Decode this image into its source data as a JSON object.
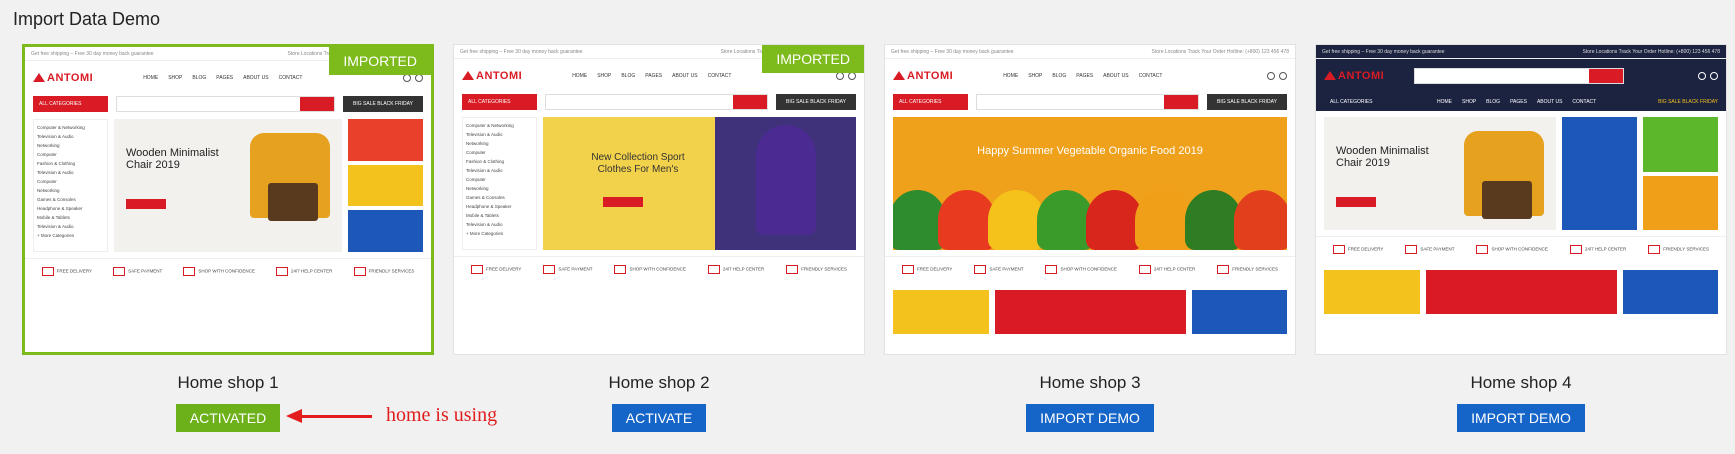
{
  "page": {
    "title": "Import Data Demo"
  },
  "badge": "IMPORTED",
  "preview": {
    "topbar_left": "Get free shipping – Free 30 day money back guarantee",
    "topbar_right": "Store Locations   Track Your Order   Hotline: (+800) 123 456 478",
    "logo": "ANTOMI",
    "menu": [
      "HOME",
      "SHOP",
      "BLOG",
      "PAGES",
      "ABOUT US",
      "CONTACT"
    ],
    "all_categories": "ALL CATEGORIES",
    "black_friday": "BIG SALE BLACK FRIDAY",
    "categories": [
      "Computer & Networking",
      "Television & Audio",
      "Networking",
      "Computer",
      "Fashion & Clothing",
      "Television & Audio",
      "Computer",
      "Networking",
      "Games & Consoles",
      "Headphone & Speaker",
      "Mobile & Tablets",
      "Television & Audio",
      "+ More Categories"
    ],
    "features": [
      "FREE DELIVERY",
      "SAFE PAYMENT",
      "SHOP WITH CONFIDENCE",
      "24/7 HELP CENTER",
      "FRIENDLY SERVICES"
    ]
  },
  "demos": [
    {
      "title": "Home shop 1",
      "button": "ACTIVATED",
      "imported": true,
      "banner": "Wooden Minimalist Chair 2019"
    },
    {
      "title": "Home shop 2",
      "button": "ACTIVATE",
      "imported": true,
      "banner": "New Collection Sport Clothes For Men's"
    },
    {
      "title": "Home shop 3",
      "button": "IMPORT DEMO",
      "imported": false,
      "banner": "Happy Summer Vegetable Organic Food 2019"
    },
    {
      "title": "Home shop 4",
      "button": "IMPORT DEMO",
      "imported": false,
      "banner": "Wooden Minimalist Chair 2019"
    }
  ],
  "annotation": {
    "text": "home is using"
  },
  "colors": {
    "accent_green": "#7dbb1d",
    "button_blue": "#1565c8",
    "brand_red": "#d81b24",
    "annotation_red": "#e11d1d"
  }
}
